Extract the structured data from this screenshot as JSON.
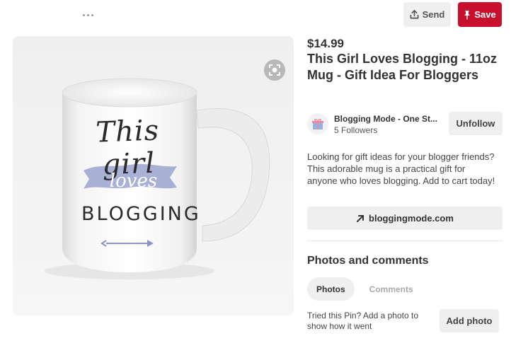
{
  "toolbar": {
    "more_icon": "more-dots-icon",
    "send_label": "Send",
    "send_icon": "share-upload-icon",
    "save_label": "Save",
    "save_icon": "pushpin-icon",
    "save_color": "#c8102e"
  },
  "image": {
    "mug_text_line1": "This girl",
    "mug_text_line2": "loves",
    "mug_text_line3": "BLOGGING",
    "lens_icon": "visual-search-icon",
    "ribbon_color": "#9aa3cf"
  },
  "pin": {
    "price": "$14.99",
    "title": "This Girl Loves Blogging - 11oz Mug - Gift Idea For Bloggers",
    "description": "Looking for gift ideas for your blogger friends? This adorable mug is a practical gift for anyone who loves blogging. Add to cart today!"
  },
  "board": {
    "avatar_icon": "gift-icon",
    "name": "Blogging Mode - One St...",
    "followers": "5 Followers",
    "unfollow_label": "Unfollow"
  },
  "link": {
    "icon": "arrow-up-right-icon",
    "label": "bloggingmode.com"
  },
  "comments": {
    "heading": "Photos and comments",
    "tabs": [
      {
        "label": "Photos",
        "active": true
      },
      {
        "label": "Comments",
        "active": false
      }
    ],
    "tried_text": "Tried this Pin? Add a photo to show how it went",
    "add_photo_label": "Add photo"
  }
}
